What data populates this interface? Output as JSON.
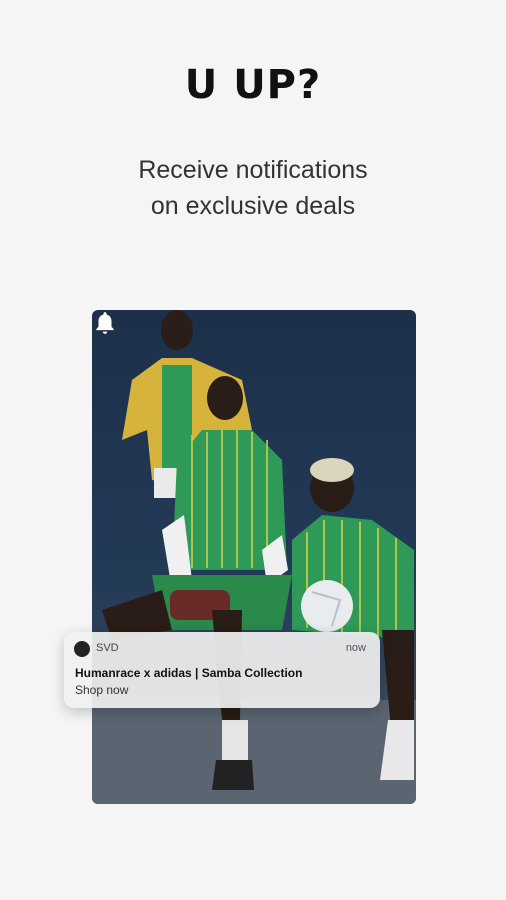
{
  "headline": "U UP?",
  "subline": {
    "line1": "Receive notifications",
    "line2": "on exclusive deals"
  },
  "hero": {
    "bell_icon": "bell-icon"
  },
  "notification": {
    "app_name": "SVD",
    "time": "now",
    "title": "Humanrace x adidas | Samba Collection",
    "body": "Shop now"
  },
  "colors": {
    "background": "#f5f5f5",
    "photo_backdrop": "#1f3550",
    "jersey_green": "#2f9a57",
    "jacket_yellow": "#d8b63a"
  }
}
